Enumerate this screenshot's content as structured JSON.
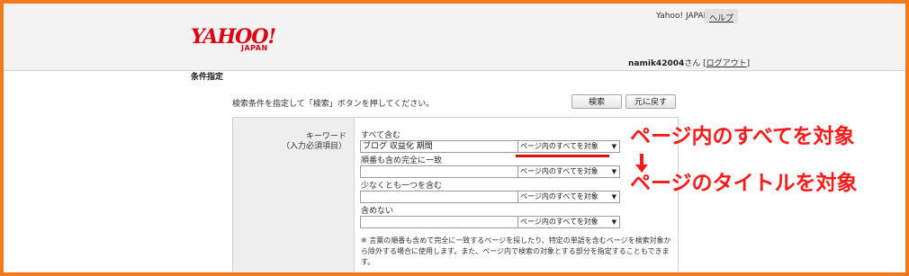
{
  "header": {
    "logo": "YAHOO!",
    "logo_sub": "JAPAN",
    "links": [
      "Yahoo! JAPAN",
      "ヘルプ"
    ],
    "user_name": "namik42004",
    "user_suffix": "さん [",
    "logout": "ログアウト",
    "logout_close": "]"
  },
  "page": {
    "section_title": "条件指定",
    "instruction": "検索条件を指定して「検索」ボタンを押してください。",
    "search_button": "検索",
    "back_button": "元に戻す"
  },
  "form": {
    "keyword_label": "キーワード",
    "keyword_required": "（入力必須項目）",
    "rows": [
      {
        "label": "すべて含む",
        "value": "ブログ 収益化 期間",
        "select": "ページ内のすべてを対象"
      },
      {
        "label": "順番も含め完全に一致",
        "value": "",
        "select": "ページ内のすべてを対象"
      },
      {
        "label": "少なくとも一つを含む",
        "value": "",
        "select": "ページ内のすべてを対象"
      },
      {
        "label": "含めない",
        "value": "",
        "select": "ページ内のすべてを対象"
      }
    ],
    "note": "※ 言葉の順番も含めて完全に一致するページを探したり、特定の単語を含むページを検索対象から除外する場合に使用します。また、ページ内で検索の対象とする部分を指定することもできます。"
  },
  "annotation": {
    "line1": "ページ内のすべてを対象",
    "line2": "ページのタイトルを対象",
    "color": "#ff1a1a"
  }
}
